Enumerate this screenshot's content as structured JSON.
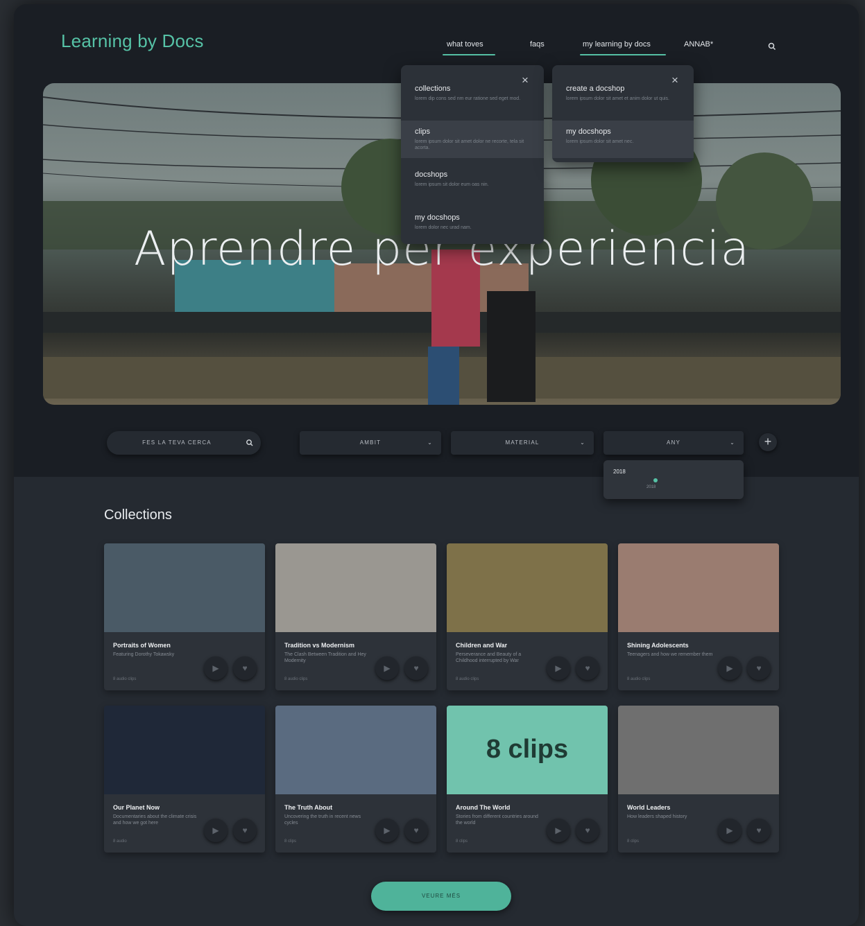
{
  "app": {
    "logo": "Learning by Docs"
  },
  "nav": {
    "items": [
      "what toves",
      "faqs",
      "my learning by docs",
      "ANNAB*"
    ],
    "search_icon": "search-icon"
  },
  "menus": {
    "left": [
      {
        "title": "collections",
        "desc": "lorem dip cons sed nm eur ratione sed eget mod."
      },
      {
        "title": "clips",
        "desc": "lorem ipsum dolor sit amet dolor ne recorte, tela sit acorta."
      },
      {
        "title": "docshops",
        "desc": "lorem ipsum sit dolor eum oas nin."
      },
      {
        "title": "my docshops",
        "desc": "lorem dolor nec urad nam."
      }
    ],
    "right": [
      {
        "title": "create a docshop",
        "desc": "lorem ipsum dolor sit amet et anim dolor ut quis."
      },
      {
        "title": "my docshops",
        "desc": "lorem ipsum dolor sit amet nec."
      }
    ],
    "close_icon": "×"
  },
  "hero": {
    "title": "Aprendre per experiencia"
  },
  "filters": {
    "search_placeholder": "FES LA TEVA CERCA",
    "selects": [
      "AMBIT",
      "MATERIAL",
      "ANY"
    ],
    "chevron": "⌄",
    "add": "+",
    "year_popup": {
      "label": "2018",
      "value": "2018"
    }
  },
  "collections": {
    "title": "Collections",
    "cards": [
      {
        "title": "Portraits of Women",
        "desc": "Featuring Dorothy Tokawsky",
        "meta": "8 audio clips",
        "thumb": "#4a5a66"
      },
      {
        "title": "Tradition vs Modernism",
        "desc": "The Clash Between Tradition and Hey Modernity",
        "meta": "8 audio clips",
        "thumb": "#9a9791"
      },
      {
        "title": "Children and War",
        "desc": "Perseverance and Beauty of a Childhood interrupted by War",
        "meta": "8 audio clips",
        "thumb": "#7e7149"
      },
      {
        "title": "Shining Adolescents",
        "desc": "Teenagers and how we remember them",
        "meta": "8 audio clips",
        "thumb": "#9a7c70"
      },
      {
        "title": "Our Planet Now",
        "desc": "Documentaries about the climate crisis and how we got here",
        "meta": "8 audio",
        "thumb": "#1f2838"
      },
      {
        "title": "The Truth About",
        "desc": "Uncovering the truth in recent news cycles",
        "meta": "8 clips",
        "thumb": "#5a6b80"
      },
      {
        "title": "Around The World",
        "desc": "Stories from different countries around the world",
        "meta": "8 clips",
        "thumb": "#71c3ad",
        "overlay": "8 clips"
      },
      {
        "title": "World Leaders",
        "desc": "How leaders shaped history",
        "meta": "8 clips",
        "thumb": "#6f6f6f"
      }
    ],
    "btn_play": "▶",
    "btn_like": "♥"
  },
  "footer": {
    "more_label": "VEURE MÉS"
  }
}
